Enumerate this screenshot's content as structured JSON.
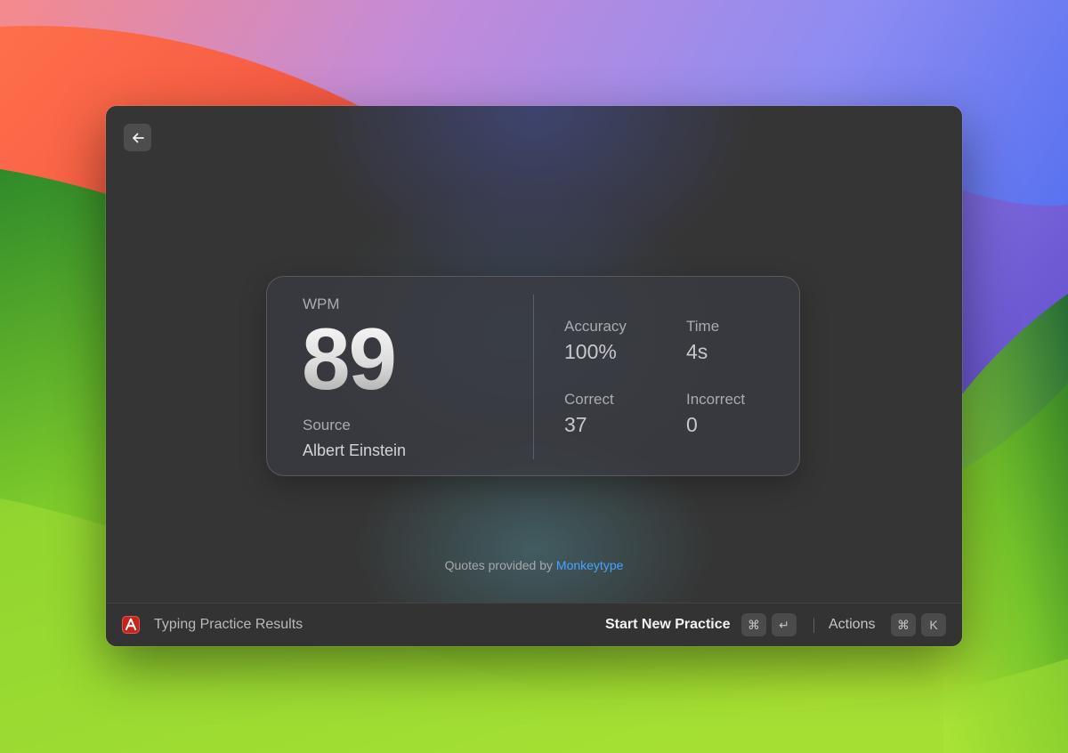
{
  "window": {
    "back_icon": "arrow-left-icon"
  },
  "stats": {
    "wpm_label": "WPM",
    "wpm_value": "89",
    "source_label": "Source",
    "source_value": "Albert Einstein",
    "accuracy_label": "Accuracy",
    "accuracy_value": "100%",
    "time_label": "Time",
    "time_value": "4s",
    "correct_label": "Correct",
    "correct_value": "37",
    "incorrect_label": "Incorrect",
    "incorrect_value": "0"
  },
  "credits": {
    "prefix": "Quotes provided by",
    "link": "Monkeytype"
  },
  "bottom_bar": {
    "app_icon": "app-logo-icon",
    "title": "Typing Practice Results",
    "primary_action": "Start New Practice",
    "primary_keys": [
      "⌘",
      "↵"
    ],
    "secondary_action": "Actions",
    "secondary_keys": [
      "⌘",
      "K"
    ]
  },
  "colors": {
    "accent_link": "#4ba0ff",
    "app_icon": "#c8241f",
    "window_bg": "#353535"
  }
}
